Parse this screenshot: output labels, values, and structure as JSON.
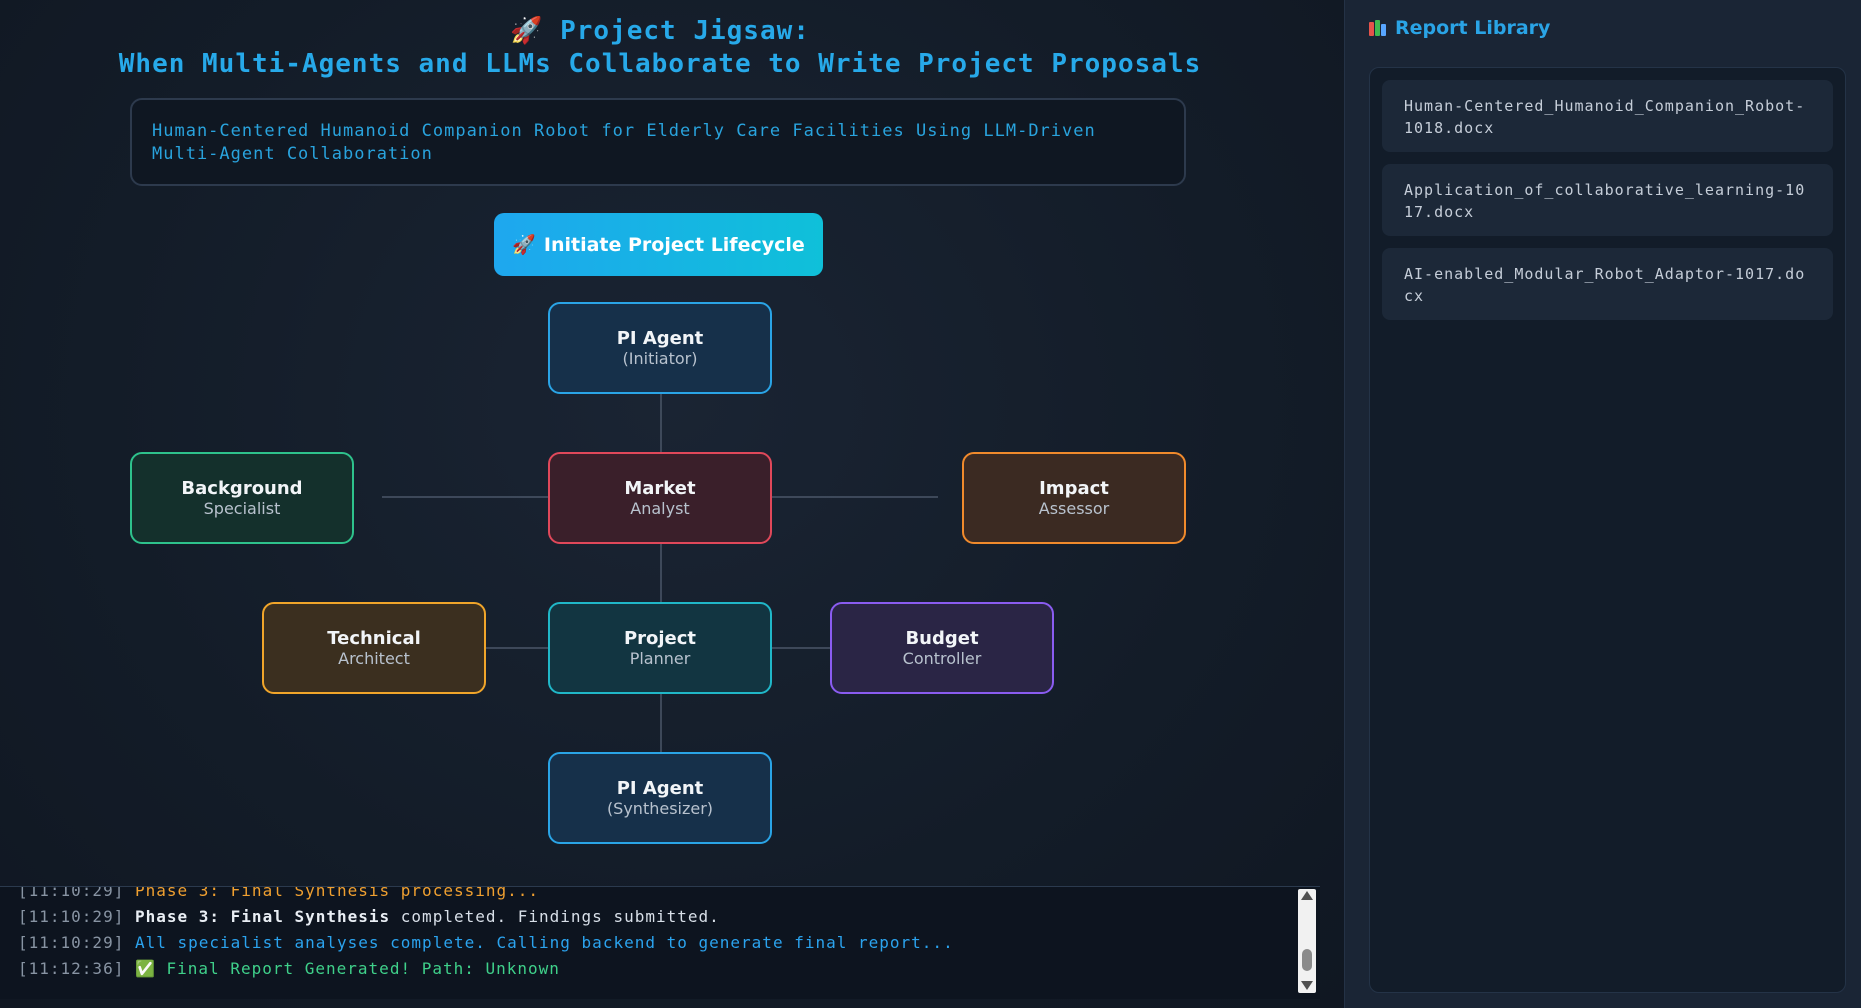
{
  "header": {
    "title_line1": "🚀 Project Jigsaw:",
    "title_line2": "When Multi-Agents and LLMs Collaborate to Write Project Proposals"
  },
  "topic": "Human-Centered Humanoid Companion Robot for Elderly Care Facilities Using LLM-Driven Multi-Agent Collaboration",
  "initiate_button": {
    "icon": "🚀",
    "label": "Initiate Project Lifecycle"
  },
  "agents": {
    "pi_initiator": {
      "name": "PI Agent",
      "role": "(Initiator)"
    },
    "background": {
      "name": "Background",
      "role": "Specialist"
    },
    "market": {
      "name": "Market",
      "role": "Analyst"
    },
    "impact": {
      "name": "Impact",
      "role": "Assessor"
    },
    "technical": {
      "name": "Technical",
      "role": "Architect"
    },
    "planner": {
      "name": "Project",
      "role": "Planner"
    },
    "budget": {
      "name": "Budget",
      "role": "Controller"
    },
    "pi_synthesizer": {
      "name": "PI Agent",
      "role": "(Synthesizer)"
    }
  },
  "log": [
    {
      "time": "[11:10:29]",
      "text": "Phase 3: Final Synthesis processing..."
    },
    {
      "time": "[11:10:29]",
      "bold": "Phase 3: Final Synthesis",
      "text": " completed. Findings submitted."
    },
    {
      "time": "[11:10:29]",
      "text": "All specialist analyses complete. Calling backend to generate final report..."
    },
    {
      "time": "[11:12:36]",
      "icon": "✅",
      "text": " Final Report Generated! Path: Unknown"
    }
  ],
  "library": {
    "title": "Report Library",
    "items": [
      "Human-Centered_Humanoid_Companion_Robot-1018.docx",
      "Application_of_collaborative_learning-1017.docx",
      "AI-enabled_Modular_Robot_Adaptor-1017.docx"
    ]
  }
}
